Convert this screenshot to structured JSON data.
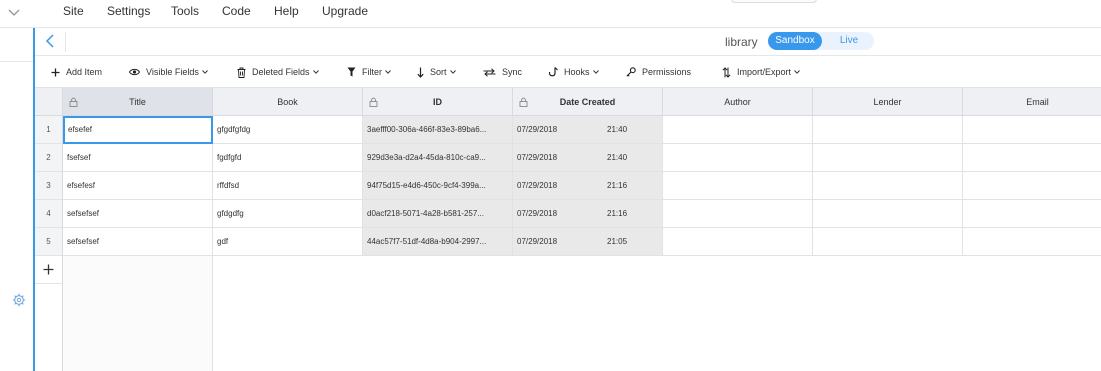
{
  "menu": {
    "items": [
      "Site",
      "Settings",
      "Tools",
      "Code",
      "Help",
      "Upgrade"
    ]
  },
  "collection": {
    "name": "library",
    "sandbox_label": "Sandbox",
    "live_label": "Live"
  },
  "toolbar": {
    "add_item": "Add Item",
    "visible_fields": "Visible Fields",
    "deleted_fields": "Deleted Fields",
    "filter": "Filter",
    "sort": "Sort",
    "sync": "Sync",
    "hooks": "Hooks",
    "permissions": "Permissions",
    "import_export": "Import/Export"
  },
  "table": {
    "columns": [
      "Title",
      "Book",
      "ID",
      "Date Created",
      "Author",
      "Lender",
      "Email"
    ],
    "rows": [
      {
        "num": "1",
        "title": "efsefef",
        "book": "gfgdfgfdg",
        "id": "3aefff00-306a-466f-83e3-89ba6...",
        "date": "07/29/2018",
        "time": "21:40"
      },
      {
        "num": "2",
        "title": "fsefsef",
        "book": "fgdfgfd",
        "id": "929d3e3a-d2a4-45da-810c-ca9...",
        "date": "07/29/2018",
        "time": "21:40"
      },
      {
        "num": "3",
        "title": "efsefesf",
        "book": "rffdfsd",
        "id": "94f75d15-e4d6-450c-9cf4-399a...",
        "date": "07/29/2018",
        "time": "21:16"
      },
      {
        "num": "4",
        "title": "sefsefsef",
        "book": "gfdgdfg",
        "id": "d0acf218-5071-4a28-b581-257...",
        "date": "07/29/2018",
        "time": "21:16"
      },
      {
        "num": "5",
        "title": "sefsefsef",
        "book": "gdf",
        "id": "44ac57f7-51df-4d8a-b904-2997...",
        "date": "07/29/2018",
        "time": "21:05"
      }
    ]
  },
  "colors": {
    "accent": "#3899ec",
    "header_bg": "#eef0f3",
    "locked_cell_bg": "#e9e9ea"
  },
  "icons": [
    "chevron-down-icon",
    "back-chevron-icon",
    "gear-icon",
    "plus-icon",
    "eye-icon",
    "trash-icon",
    "filter-icon",
    "sort-icon",
    "sync-icon",
    "hooks-icon",
    "key-icon",
    "import-export-icon",
    "lock-icon"
  ]
}
